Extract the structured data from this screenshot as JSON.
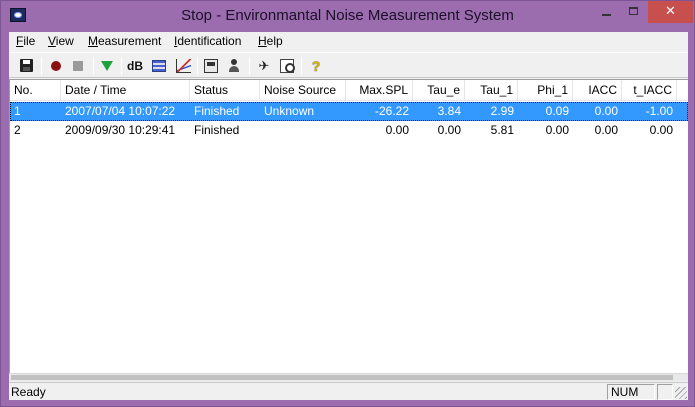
{
  "window": {
    "title": "Stop - Environmantal Noise Measurement System",
    "controls": {
      "minimize": "–",
      "maximize": "□",
      "close": "✕"
    }
  },
  "menu": [
    "File",
    "View",
    "Measurement",
    "Identification",
    "Help"
  ],
  "toolbar": {
    "icons": [
      "save-icon",
      "record-icon",
      "stop-icon",
      "filter-icon",
      "db-icon",
      "level-bars-icon",
      "graph-icon",
      "properties-icon",
      "identify-icon",
      "aircraft-icon",
      "find-icon",
      "help-icon"
    ],
    "db_label": "dB",
    "help_label": "?"
  },
  "table": {
    "columns": [
      "No.",
      "Date / Time",
      "Status",
      "Noise Source",
      "Max.SPL",
      "Tau_e",
      "Tau_1",
      "Phi_1",
      "IACC",
      "t_IACC"
    ],
    "rows": [
      {
        "no": "1",
        "datetime": "2007/07/04 10:07:22",
        "status": "Finished",
        "source": "Unknown",
        "maxspl": "-26.22",
        "tau_e": "3.84",
        "tau_1": "2.99",
        "phi_1": "0.09",
        "iacc": "0.00",
        "t_iacc": "-1.00",
        "selected": true
      },
      {
        "no": "2",
        "datetime": "2009/09/30 10:29:41",
        "status": "Finished",
        "source": "",
        "maxspl": "0.00",
        "tau_e": "0.00",
        "tau_1": "5.81",
        "phi_1": "0.00",
        "iacc": "0.00",
        "t_iacc": "0.00",
        "selected": false
      }
    ]
  },
  "status": {
    "text": "Ready",
    "num": "NUM"
  },
  "colors": {
    "frame": "#9b6cae",
    "selection": "#3399ff",
    "close": "#c7504f"
  }
}
